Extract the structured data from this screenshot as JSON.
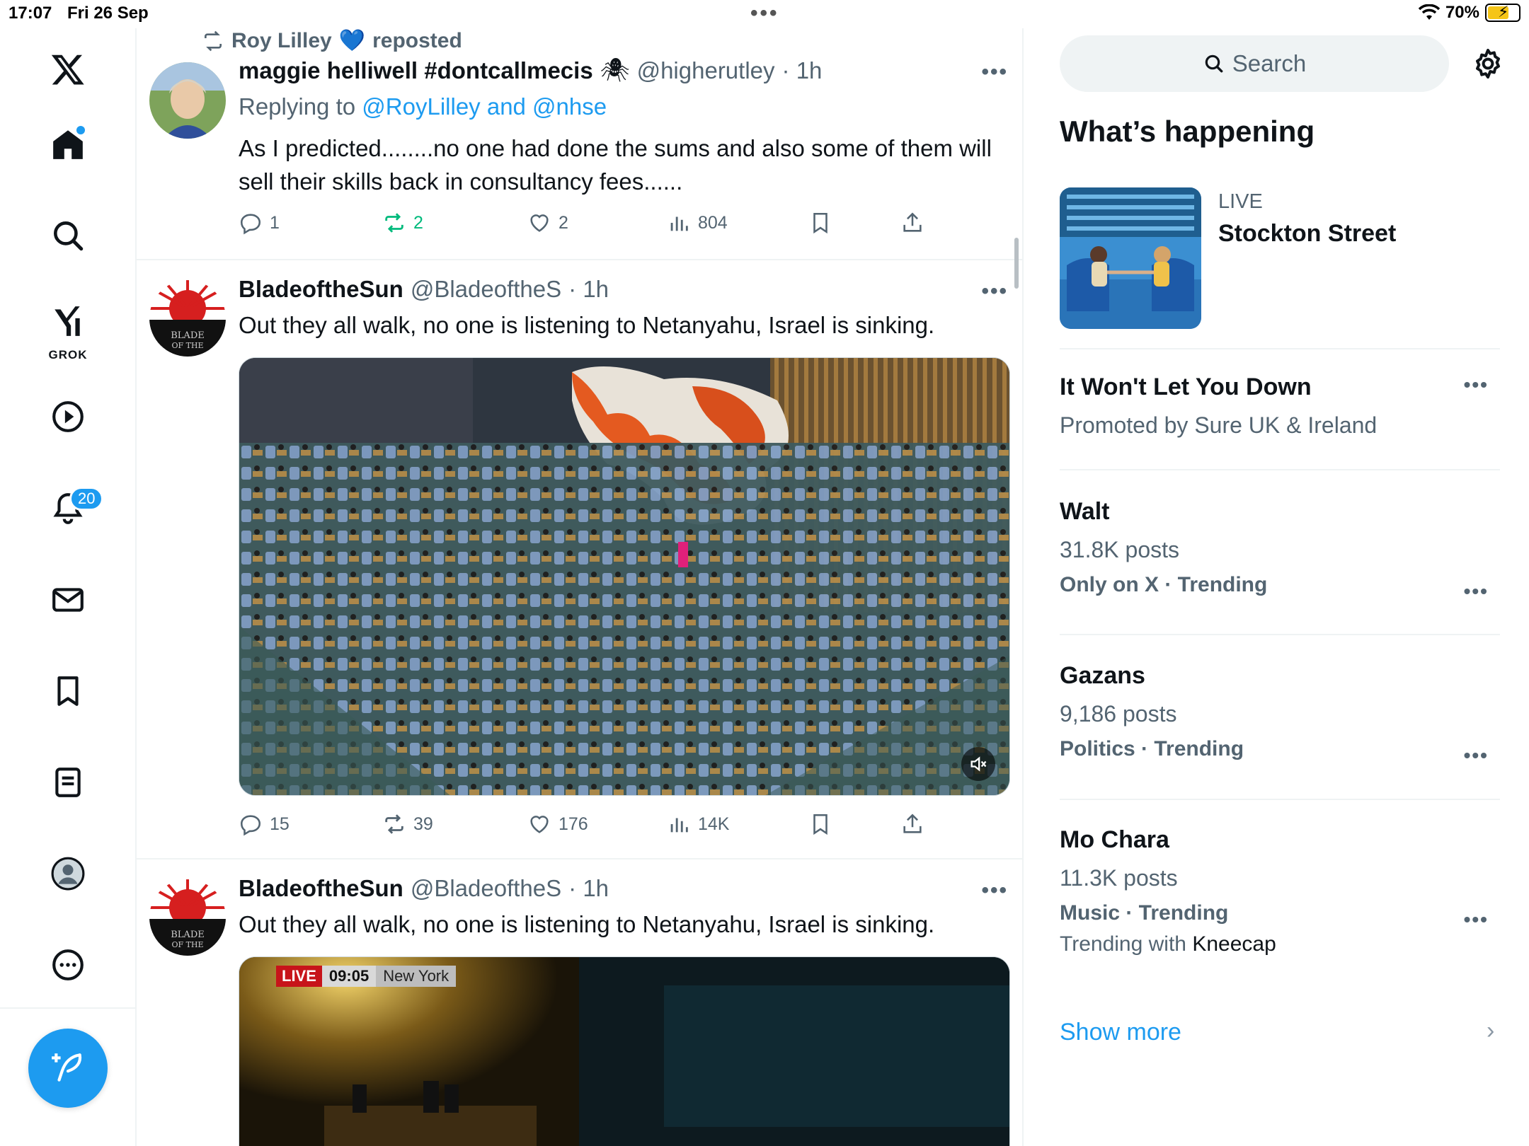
{
  "status_bar": {
    "time": "17:07",
    "date": "Fri 26 Sep",
    "battery": "70%",
    "battery_level": 0.7
  },
  "nav": {
    "notifications_badge": "20",
    "grok_label": "GROK"
  },
  "feed": {
    "tweets": [
      {
        "repost_by": "Roy Lilley",
        "repost_suffix": "reposted",
        "name": "maggie helliwell #dontcallmecis",
        "handle": "@higherutley",
        "time": "· 1h",
        "replying_prefix": "Replying to",
        "replying_users": "@RoyLilley and @nhse",
        "text": "As I predicted........no one had done the sums and also some of them will sell their skills back in consultancy fees......",
        "replies": "1",
        "reposts": "2",
        "likes": "2",
        "views": "804"
      },
      {
        "name": "BladeoftheSun",
        "handle": "@BladeoftheS",
        "time": "· 1h",
        "text": "Out they all walk, no one is listening to Netanyahu, Israel is sinking.",
        "replies": "15",
        "reposts": "39",
        "likes": "176",
        "views": "14K"
      },
      {
        "name": "BladeoftheSun",
        "handle": "@BladeoftheS",
        "time": "· 1h",
        "text": "Out they all walk, no one is listening to Netanyahu, Israel is sinking.",
        "media_badge_live": "LIVE",
        "media_badge_time": "09:05",
        "media_badge_place": "New York"
      }
    ]
  },
  "sidebar": {
    "search_placeholder": "Search",
    "section_title": "What’s happening",
    "live_card": {
      "label": "LIVE",
      "title": "Stockton Street"
    },
    "trends": [
      {
        "title": "It Won't Let You Down",
        "sub": "Promoted by Sure UK & Ireland"
      },
      {
        "title": "Walt",
        "sub": "31.8K posts",
        "meta": "Only on X · Trending"
      },
      {
        "title": "Gazans",
        "sub": "9,186 posts",
        "meta": "Politics · Trending"
      },
      {
        "title": "Mo Chara",
        "sub": "11.3K posts",
        "meta": "Music · Trending",
        "with_prefix": "Trending with",
        "with_name": "Kneecap"
      }
    ],
    "show_more": "Show more"
  },
  "colors": {
    "accent": "#1d9bf0",
    "repost_active": "#00ba7c",
    "secondary_text": "#536471"
  }
}
